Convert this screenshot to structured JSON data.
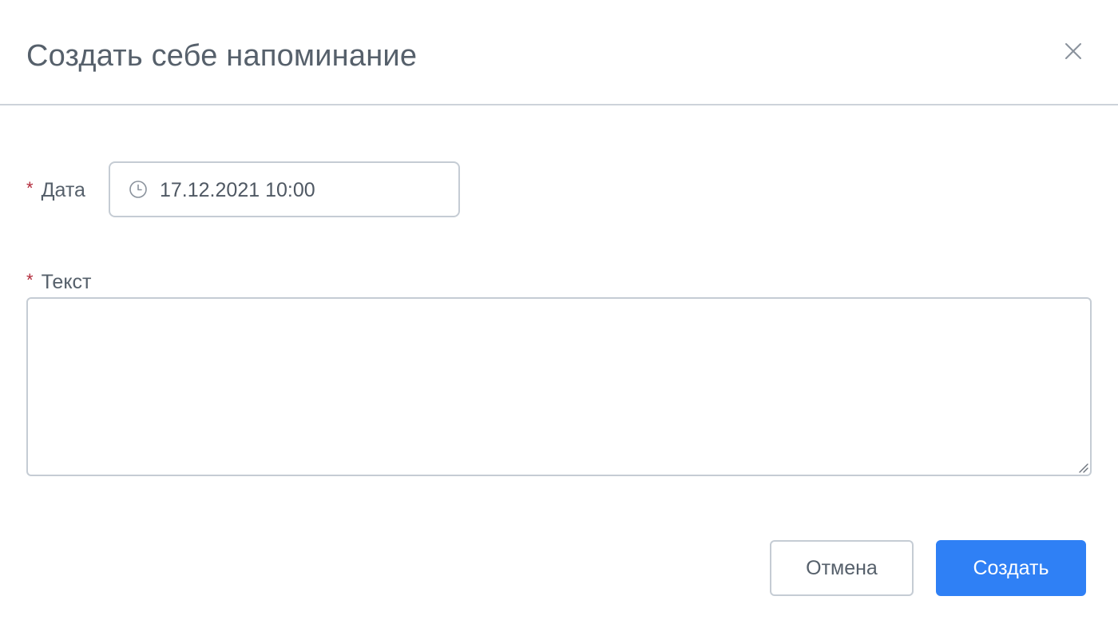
{
  "modal": {
    "title": "Создать себе напоминание"
  },
  "form": {
    "required_mark": "*",
    "date": {
      "label": "Дата",
      "value": "17.12.2021 10:00",
      "icon": "clock-icon"
    },
    "text": {
      "label": "Текст",
      "value": ""
    }
  },
  "actions": {
    "cancel_label": "Отмена",
    "create_label": "Создать"
  },
  "colors": {
    "primary": "#2f80f5",
    "required": "#b22a3a",
    "border": "#c5ccd4",
    "text": "#56606b"
  }
}
